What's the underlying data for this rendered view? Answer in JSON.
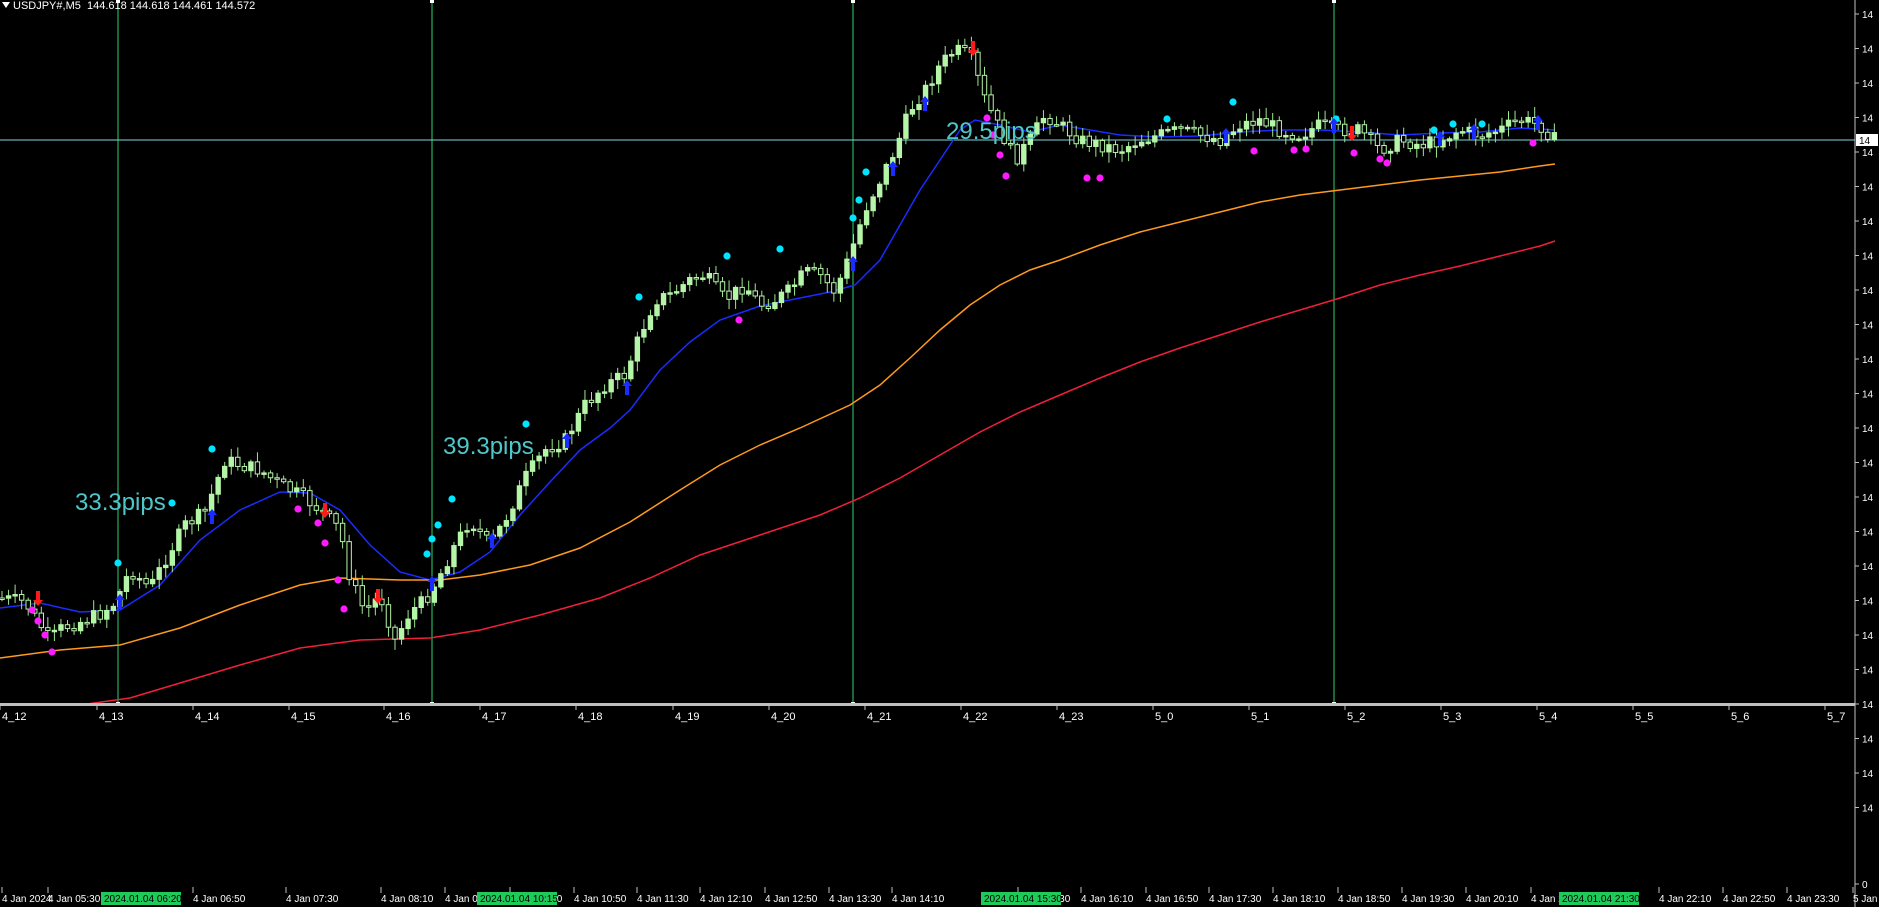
{
  "header": {
    "symbol": "USDJPY#,M5",
    "ohlc": "144.618 144.618 144.461 144.572"
  },
  "colors": {
    "bg": "#000000",
    "bull": "#b5f5a8",
    "wick": "#9ee890",
    "ema_fast": "#1a2cff",
    "ema_mid": "#ff9a1f",
    "ema_slow": "#f0203a",
    "vline": "#2bd46a",
    "hline": "#7fd8e0",
    "label": "#4fc7c9",
    "buy_arrow": "#1a2cff",
    "sell_arrow": "#ff1a1a",
    "dot_up": "#00e5ff",
    "dot_down": "#ff1aff"
  },
  "chart_data": {
    "type": "candlestick",
    "x_range": [
      0,
      1860
    ],
    "price_range": [
      0,
      705
    ],
    "session_labels": [
      "4_12",
      "4_13",
      "4_14",
      "4_15",
      "4_16",
      "4_17",
      "4_18",
      "4_19",
      "4_20",
      "4_21",
      "4_22",
      "4_23",
      "5_0",
      "5_1",
      "5_2",
      "5_3",
      "5_4",
      "5_5",
      "5_6",
      "5_7"
    ],
    "time_labels": [
      "4 Jan 2024",
      "4 Jan 05:30",
      "4 Jan 06:50",
      "4 Jan 07:30",
      "4 Jan 08:10",
      "4 Jan 08:50",
      "4 Jan 09:30",
      "4 Jan 10:50",
      "4 Jan 11:30",
      "4 Jan 12:10",
      "4 Jan 12:50",
      "4 Jan 13:30",
      "4 Jan 14:10",
      "4 Jan 15:30",
      "4 Jan 16:10",
      "4 Jan 16:50",
      "4 Jan 17:30",
      "4 Jan 18:10",
      "4 Jan 18:50",
      "4 Jan 19:30",
      "4 Jan 20:10",
      "4 Jan 20:50",
      "4 Jan 22:10",
      "4 Jan 22:50",
      "4 Jan 23:30",
      "5 Jan"
    ],
    "highlight_times": [
      "2024.01.04 06:20",
      "2024.01.04 10:15",
      "2024.01.04 15:30",
      "2024.01.04 21:30"
    ],
    "pip_labels": [
      "33.3pips",
      "39.3pips",
      "29.5pips"
    ],
    "right_axis_ticks": [
      "14",
      "14",
      "14",
      "14",
      "14",
      "14",
      "14",
      "14",
      "14",
      "14",
      "14",
      "14",
      "14",
      "14",
      "14",
      "14",
      "14",
      "14",
      "14",
      "14",
      "14",
      "14",
      "14",
      "14",
      "0"
    ],
    "price_marker": "14",
    "close_path": [
      [
        0,
        598
      ],
      [
        25,
        602
      ],
      [
        50,
        640
      ],
      [
        62,
        628
      ],
      [
        80,
        622
      ],
      [
        100,
        614
      ],
      [
        115,
        603
      ],
      [
        130,
        570
      ],
      [
        150,
        588
      ],
      [
        165,
        560
      ],
      [
        185,
        525
      ],
      [
        205,
        512
      ],
      [
        225,
        460
      ],
      [
        240,
        465
      ],
      [
        260,
        470
      ],
      [
        280,
        485
      ],
      [
        300,
        495
      ],
      [
        320,
        510
      ],
      [
        340,
        530
      ],
      [
        350,
        578
      ],
      [
        365,
        612
      ],
      [
        380,
        595
      ],
      [
        395,
        640
      ],
      [
        410,
        612
      ],
      [
        425,
        600
      ],
      [
        440,
        575
      ],
      [
        455,
        545
      ],
      [
        470,
        520
      ],
      [
        490,
        545
      ],
      [
        505,
        520
      ],
      [
        525,
        478
      ],
      [
        545,
        450
      ],
      [
        565,
        440
      ],
      [
        585,
        405
      ],
      [
        605,
        385
      ],
      [
        625,
        375
      ],
      [
        640,
        335
      ],
      [
        655,
        300
      ],
      [
        670,
        295
      ],
      [
        690,
        280
      ],
      [
        705,
        275
      ],
      [
        725,
        300
      ],
      [
        745,
        285
      ],
      [
        760,
        305
      ],
      [
        775,
        300
      ],
      [
        790,
        290
      ],
      [
        805,
        272
      ],
      [
        820,
        275
      ],
      [
        835,
        292
      ],
      [
        850,
        255
      ],
      [
        865,
        210
      ],
      [
        885,
        170
      ],
      [
        895,
        150
      ],
      [
        910,
        110
      ],
      [
        925,
        90
      ],
      [
        940,
        65
      ],
      [
        955,
        50
      ],
      [
        970,
        55
      ],
      [
        985,
        100
      ],
      [
        1000,
        130
      ],
      [
        1015,
        160
      ],
      [
        1030,
        140
      ],
      [
        1045,
        115
      ],
      [
        1060,
        125
      ],
      [
        1080,
        140
      ],
      [
        1100,
        145
      ],
      [
        1120,
        150
      ],
      [
        1140,
        140
      ],
      [
        1160,
        135
      ],
      [
        1180,
        130
      ],
      [
        1200,
        135
      ],
      [
        1220,
        140
      ],
      [
        1240,
        125
      ],
      [
        1260,
        120
      ],
      [
        1280,
        130
      ],
      [
        1300,
        135
      ],
      [
        1320,
        125
      ],
      [
        1340,
        130
      ],
      [
        1360,
        130
      ],
      [
        1380,
        150
      ],
      [
        1400,
        140
      ],
      [
        1420,
        145
      ],
      [
        1440,
        140
      ],
      [
        1460,
        130
      ],
      [
        1480,
        135
      ],
      [
        1500,
        130
      ],
      [
        1520,
        120
      ],
      [
        1540,
        125
      ],
      [
        1555,
        140
      ]
    ],
    "series": [
      {
        "name": "ema_fast",
        "points": [
          [
            0,
            608
          ],
          [
            40,
            603
          ],
          [
            80,
            612
          ],
          [
            120,
            610
          ],
          [
            160,
            585
          ],
          [
            200,
            540
          ],
          [
            240,
            510
          ],
          [
            280,
            492
          ],
          [
            310,
            493
          ],
          [
            340,
            510
          ],
          [
            370,
            545
          ],
          [
            400,
            572
          ],
          [
            430,
            580
          ],
          [
            460,
            572
          ],
          [
            490,
            552
          ],
          [
            520,
            515
          ],
          [
            550,
            482
          ],
          [
            580,
            450
          ],
          [
            610,
            428
          ],
          [
            630,
            410
          ],
          [
            660,
            370
          ],
          [
            690,
            342
          ],
          [
            720,
            320
          ],
          [
            760,
            306
          ],
          [
            800,
            298
          ],
          [
            830,
            292
          ],
          [
            855,
            285
          ],
          [
            880,
            260
          ],
          [
            900,
            225
          ],
          [
            920,
            190
          ],
          [
            940,
            160
          ],
          [
            960,
            130
          ],
          [
            975,
            120
          ],
          [
            1000,
            125
          ],
          [
            1030,
            132
          ],
          [
            1060,
            125
          ],
          [
            1090,
            130
          ],
          [
            1120,
            135
          ],
          [
            1160,
            137
          ],
          [
            1200,
            136
          ],
          [
            1240,
            132
          ],
          [
            1280,
            130
          ],
          [
            1320,
            130
          ],
          [
            1360,
            132
          ],
          [
            1400,
            135
          ],
          [
            1440,
            133
          ],
          [
            1480,
            132
          ],
          [
            1520,
            128
          ],
          [
            1555,
            130
          ]
        ]
      },
      {
        "name": "ema_mid",
        "points": [
          [
            0,
            658
          ],
          [
            60,
            650
          ],
          [
            120,
            645
          ],
          [
            180,
            628
          ],
          [
            240,
            605
          ],
          [
            300,
            585
          ],
          [
            340,
            578
          ],
          [
            400,
            580
          ],
          [
            440,
            580
          ],
          [
            480,
            575
          ],
          [
            530,
            565
          ],
          [
            580,
            548
          ],
          [
            630,
            522
          ],
          [
            680,
            490
          ],
          [
            720,
            465
          ],
          [
            760,
            445
          ],
          [
            800,
            428
          ],
          [
            850,
            405
          ],
          [
            880,
            385
          ],
          [
            910,
            358
          ],
          [
            940,
            330
          ],
          [
            970,
            305
          ],
          [
            1000,
            285
          ],
          [
            1030,
            270
          ],
          [
            1060,
            260
          ],
          [
            1100,
            245
          ],
          [
            1140,
            232
          ],
          [
            1180,
            222
          ],
          [
            1220,
            212
          ],
          [
            1260,
            202
          ],
          [
            1300,
            195
          ],
          [
            1340,
            190
          ],
          [
            1380,
            185
          ],
          [
            1420,
            180
          ],
          [
            1460,
            176
          ],
          [
            1500,
            172
          ],
          [
            1540,
            166
          ],
          [
            1555,
            164
          ]
        ]
      },
      {
        "name": "ema_slow",
        "points": [
          [
            80,
            705
          ],
          [
            130,
            698
          ],
          [
            180,
            683
          ],
          [
            240,
            665
          ],
          [
            300,
            648
          ],
          [
            360,
            640
          ],
          [
            430,
            638
          ],
          [
            480,
            630
          ],
          [
            540,
            615
          ],
          [
            600,
            598
          ],
          [
            650,
            578
          ],
          [
            700,
            555
          ],
          [
            760,
            535
          ],
          [
            820,
            515
          ],
          [
            860,
            498
          ],
          [
            900,
            478
          ],
          [
            940,
            455
          ],
          [
            980,
            432
          ],
          [
            1020,
            412
          ],
          [
            1060,
            395
          ],
          [
            1100,
            378
          ],
          [
            1140,
            362
          ],
          [
            1180,
            348
          ],
          [
            1220,
            335
          ],
          [
            1260,
            322
          ],
          [
            1300,
            310
          ],
          [
            1340,
            298
          ],
          [
            1380,
            285
          ],
          [
            1420,
            275
          ],
          [
            1460,
            266
          ],
          [
            1500,
            256
          ],
          [
            1540,
            246
          ],
          [
            1555,
            241
          ]
        ]
      }
    ],
    "signals": {
      "buy_arrows": [
        [
          120,
          603
        ],
        [
          212,
          518
        ],
        [
          432,
          585
        ],
        [
          492,
          542
        ],
        [
          567,
          442
        ],
        [
          627,
          389
        ],
        [
          853,
          265
        ],
        [
          893,
          170
        ],
        [
          925,
          105
        ],
        [
          1226,
          137
        ],
        [
          1334,
          127
        ],
        [
          1440,
          140
        ],
        [
          1474,
          133
        ],
        [
          1538,
          124
        ]
      ],
      "sell_arrows": [
        [
          38,
          597
        ],
        [
          325,
          509
        ],
        [
          378,
          595
        ],
        [
          973,
          47
        ],
        [
          1352,
          132
        ]
      ],
      "up_dots": [
        [
          118,
          563
        ],
        [
          172,
          503
        ],
        [
          212,
          449
        ],
        [
          427,
          554
        ],
        [
          432,
          539
        ],
        [
          438,
          525
        ],
        [
          452,
          499
        ],
        [
          526,
          424
        ],
        [
          639,
          297
        ],
        [
          727,
          256
        ],
        [
          780,
          249
        ],
        [
          853,
          218
        ],
        [
          859,
          200
        ],
        [
          866,
          172
        ],
        [
          1167,
          119
        ],
        [
          1233,
          102
        ],
        [
          1336,
          119
        ],
        [
          1434,
          130
        ],
        [
          1453,
          124
        ],
        [
          1482,
          124
        ]
      ],
      "down_dots": [
        [
          32,
          610
        ],
        [
          38,
          621
        ],
        [
          45,
          635
        ],
        [
          52,
          652
        ],
        [
          298,
          509
        ],
        [
          318,
          523
        ],
        [
          325,
          543
        ],
        [
          338,
          580
        ],
        [
          344,
          609
        ],
        [
          739,
          320
        ],
        [
          987,
          118
        ],
        [
          993,
          135
        ],
        [
          1000,
          155
        ],
        [
          1006,
          176
        ],
        [
          1087,
          178
        ],
        [
          1100,
          178
        ],
        [
          1254,
          151
        ],
        [
          1294,
          150
        ],
        [
          1306,
          149
        ],
        [
          1354,
          153
        ],
        [
          1380,
          159
        ],
        [
          1387,
          163
        ],
        [
          1533,
          143
        ]
      ]
    }
  }
}
